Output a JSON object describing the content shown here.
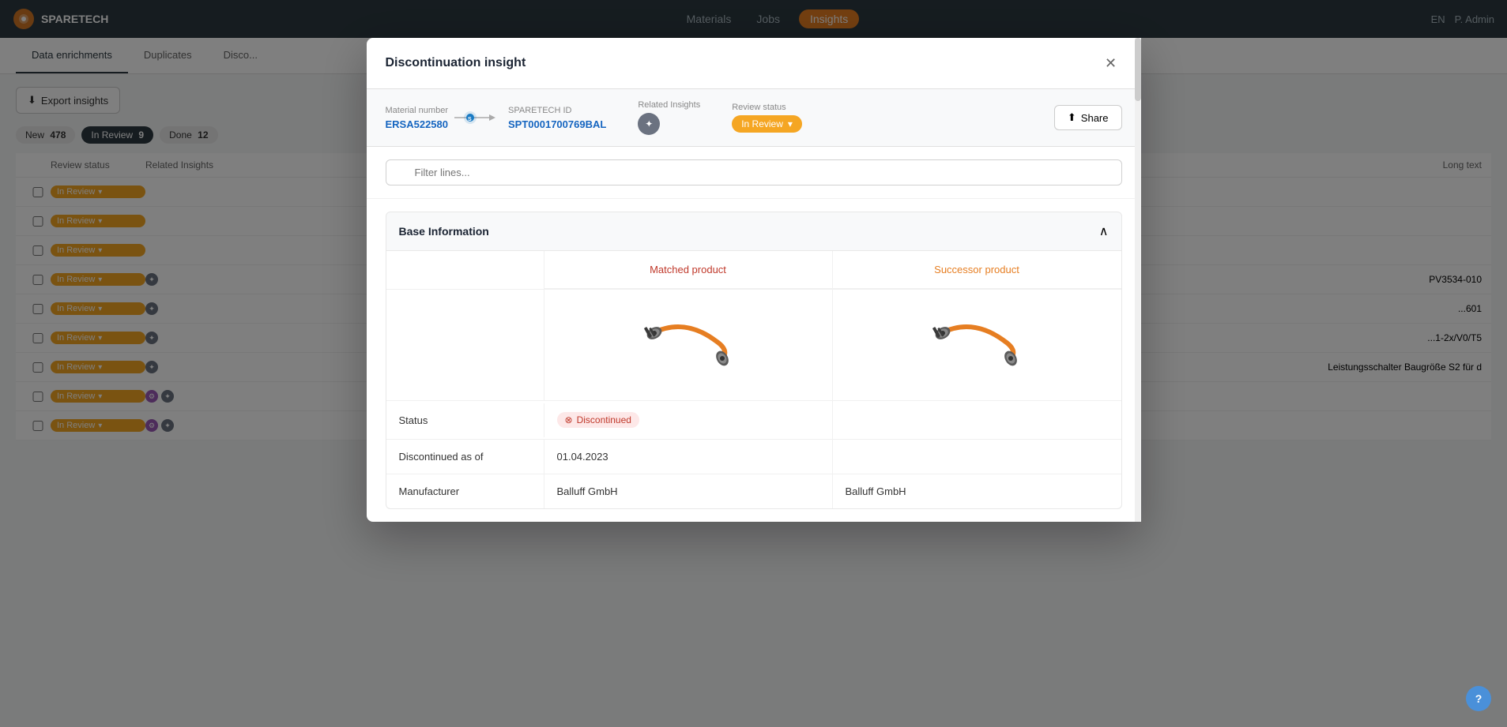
{
  "app": {
    "name": "SPARETECH",
    "nav": {
      "links": [
        "Materials",
        "Jobs",
        "Insights"
      ],
      "active": "Insights",
      "lang": "EN",
      "user": "P. Admin"
    }
  },
  "page": {
    "tabs": [
      "Data enrichments",
      "Duplicates",
      "Disco..."
    ],
    "active_tab": "Data enrichments",
    "export_btn": "Export insights",
    "filters": [
      {
        "label": "New",
        "count": "478"
      },
      {
        "label": "In Review",
        "count": "9"
      },
      {
        "label": "Done",
        "count": "12"
      }
    ],
    "active_filter": "In Review",
    "table": {
      "headers": [
        "",
        "Review status",
        "Related Insights",
        "Long text"
      ],
      "rows": [
        {
          "status": "In Review",
          "has_icon": false,
          "long_text": ""
        },
        {
          "status": "In Review",
          "has_icon": false,
          "long_text": ""
        },
        {
          "status": "In Review",
          "has_icon": false,
          "long_text": ""
        },
        {
          "status": "In Review",
          "has_icon": true,
          "long_text": "PV3534-010"
        },
        {
          "status": "In Review",
          "has_icon": true,
          "long_text": "...601"
        },
        {
          "status": "In Review",
          "has_icon": true,
          "long_text": "...1-2x/V0/T5"
        },
        {
          "status": "In Review",
          "has_icon": true,
          "long_text": "Leistungsschalter Baugröße S2 für d"
        },
        {
          "status": "In Review",
          "has_icon2": true,
          "long_text": ""
        },
        {
          "status": "In Review",
          "has_icon2": true,
          "long_text": ""
        }
      ]
    }
  },
  "modal": {
    "title": "Discontinuation insight",
    "material_number_label": "Material number",
    "material_number_value": "ERSA522580",
    "sparetech_id_label": "SPARETECH ID",
    "sparetech_id_value": "SPT0001700769BAL",
    "related_insights_label": "Related Insights",
    "review_status_label": "Review status",
    "review_status_value": "In Review",
    "share_btn": "Share",
    "filter_placeholder": "Filter lines...",
    "section_title": "Base Information",
    "matched_product_label": "Matched product",
    "successor_product_label": "Successor product",
    "status_label": "Status",
    "status_value": "Discontinued",
    "discontinued_date_label": "Discontinued as of",
    "discontinued_date_value": "01.04.2023",
    "manufacturer_label": "Manufacturer",
    "manufacturer_matched": "Balluff GmbH",
    "manufacturer_successor": "Balluff GmbH"
  },
  "icons": {
    "close": "✕",
    "chevron_up": "∧",
    "chevron_down": "∨",
    "search": "🔍",
    "share": "↑",
    "download": "↓",
    "wrench": "🔧",
    "info": "ℹ",
    "help": "?"
  }
}
